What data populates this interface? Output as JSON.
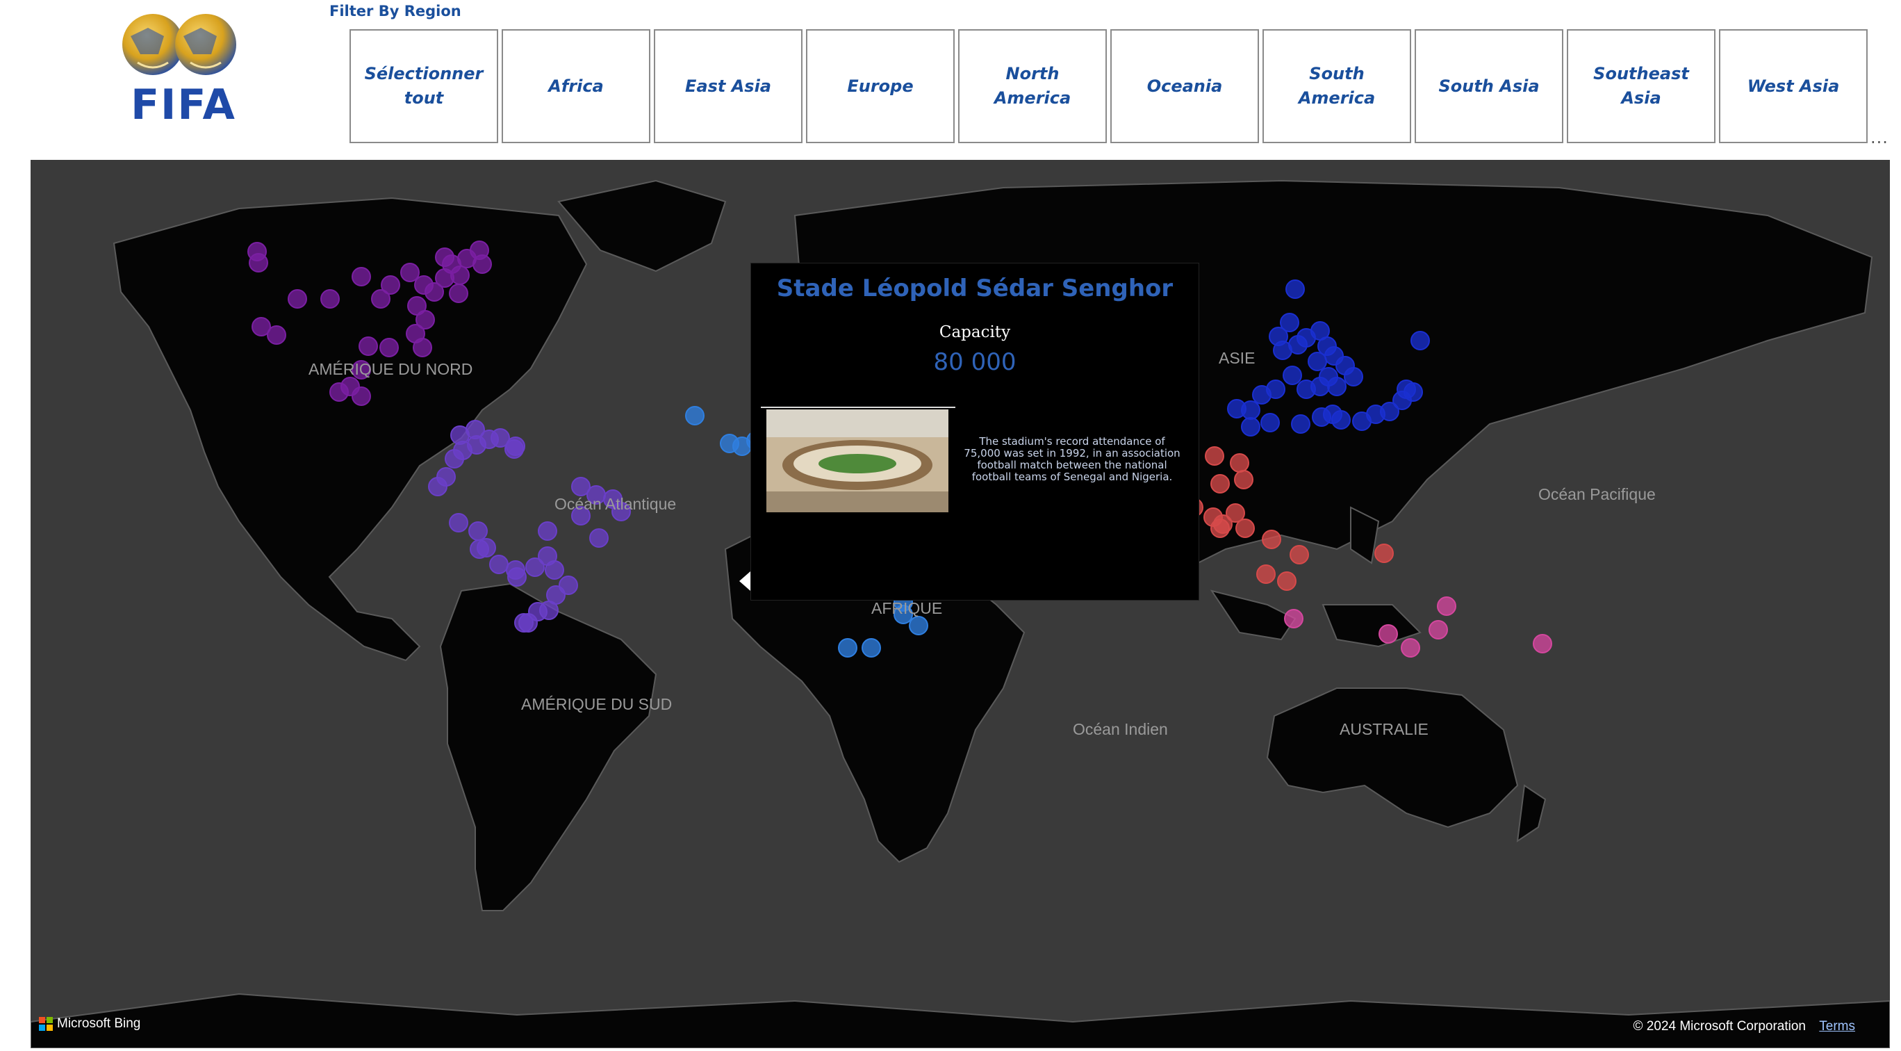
{
  "logo": {
    "text": "FIFA"
  },
  "filter": {
    "title": "Filter By Region",
    "options": [
      "Sélectionner tout",
      "Africa",
      "East Asia",
      "Europe",
      "North America",
      "Oceania",
      "South America",
      "South Asia",
      "Southeast Asia",
      "West Asia"
    ]
  },
  "more_options": "...",
  "map": {
    "labels": {
      "north_america": "AMÉRIQUE DU NORD",
      "atlantic": "Océan Atlantique",
      "south_america": "AMÉRIQUE DU SUD",
      "africa": "AFRIQUE",
      "asia": "ASIE",
      "pacific": "Océan Pacifique",
      "indian": "Océan Indien",
      "australia": "AUSTRALIE"
    },
    "attribution": "Microsoft Bing",
    "copyright": "© 2024 Microsoft Corporation",
    "terms": "Terms",
    "region_colors": {
      "North America": "#7a1fa2",
      "South America": "#6a3fc8",
      "Africa": "#2f7fe0",
      "East Asia": "#1a2fd0",
      "Southeast Asia": "#d64a4a",
      "Oceania": "#d4479e",
      "South Asia": "#d6b12a"
    }
  },
  "tooltip": {
    "stadium": "Stade Léopold Sédar Senghor",
    "capacity_label": "Capacity",
    "capacity_value": "80 000",
    "description": "The stadium's record attendance of 75,000 was set in 1992, in an association football match between the national football teams of Senegal and Nigeria."
  }
}
